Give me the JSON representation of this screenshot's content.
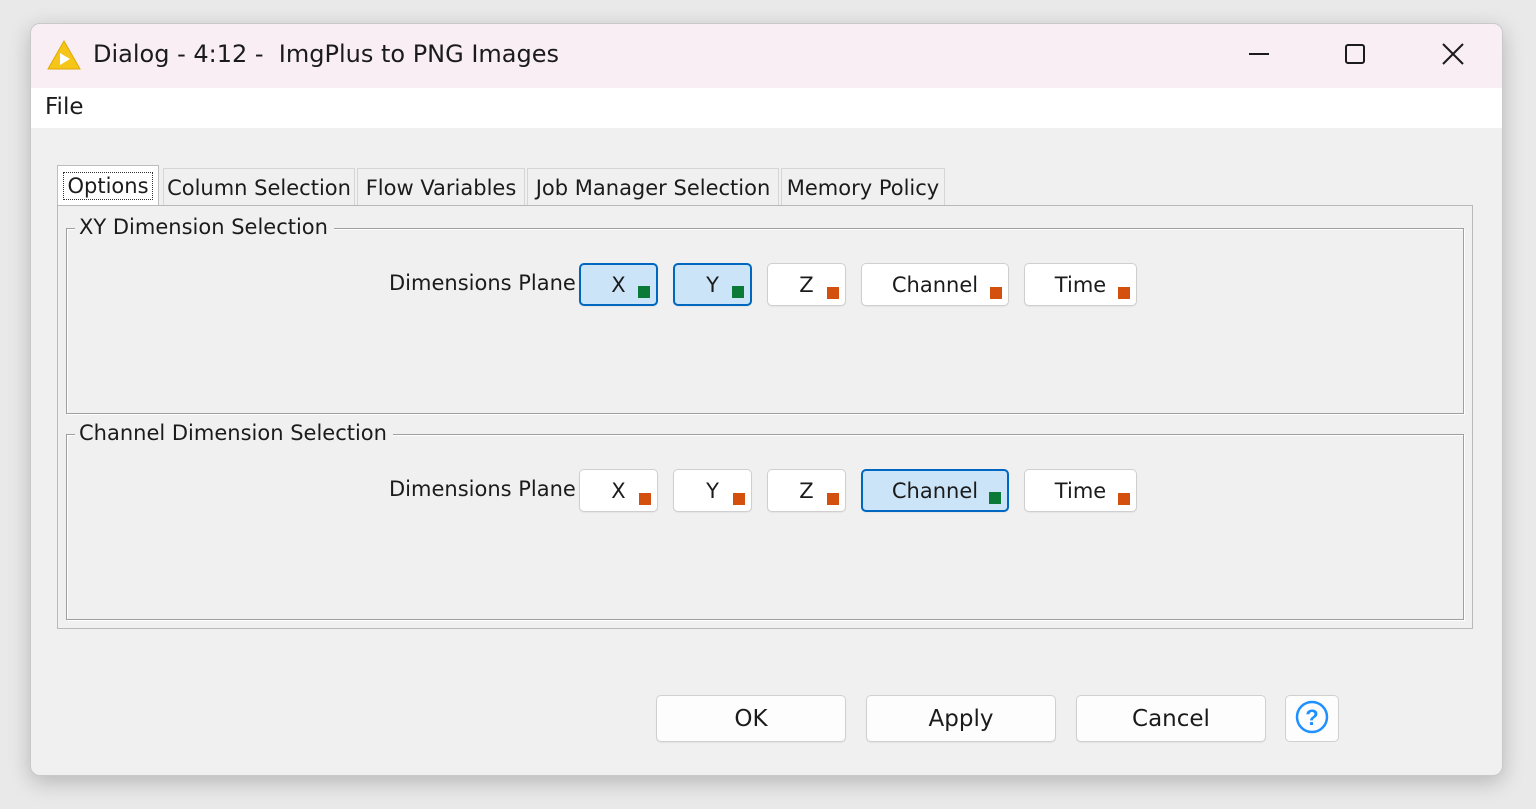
{
  "window": {
    "title": "Dialog - 4:12 -  ImgPlus to PNG Images"
  },
  "menu": {
    "items": [
      {
        "label": "File"
      }
    ]
  },
  "tabs": [
    {
      "label": "Options",
      "active": true
    },
    {
      "label": "Column Selection",
      "active": false
    },
    {
      "label": "Flow Variables",
      "active": false
    },
    {
      "label": "Job Manager Selection",
      "active": false
    },
    {
      "label": "Memory Policy",
      "active": false
    }
  ],
  "groups": [
    {
      "title": "XY Dimension Selection",
      "row_label": "Dimensions Plane",
      "buttons": [
        {
          "label": "X",
          "selected": true
        },
        {
          "label": "Y",
          "selected": true
        },
        {
          "label": "Z",
          "selected": false
        },
        {
          "label": "Channel",
          "selected": false
        },
        {
          "label": "Time",
          "selected": false
        }
      ]
    },
    {
      "title": "Channel Dimension Selection",
      "row_label": "Dimensions Plane",
      "buttons": [
        {
          "label": "X",
          "selected": false
        },
        {
          "label": "Y",
          "selected": false
        },
        {
          "label": "Z",
          "selected": false
        },
        {
          "label": "Channel",
          "selected": true
        },
        {
          "label": "Time",
          "selected": false
        }
      ]
    }
  ],
  "footer": {
    "ok_label": "OK",
    "apply_label": "Apply",
    "cancel_label": "Cancel",
    "help_icon": "help-icon"
  },
  "colors": {
    "selected_indicator": "#0b7a36",
    "unselected_indicator": "#d4500f",
    "selected_fill": "#cce4f7",
    "selected_border": "#0067c0",
    "app_icon": "#f5c518"
  }
}
